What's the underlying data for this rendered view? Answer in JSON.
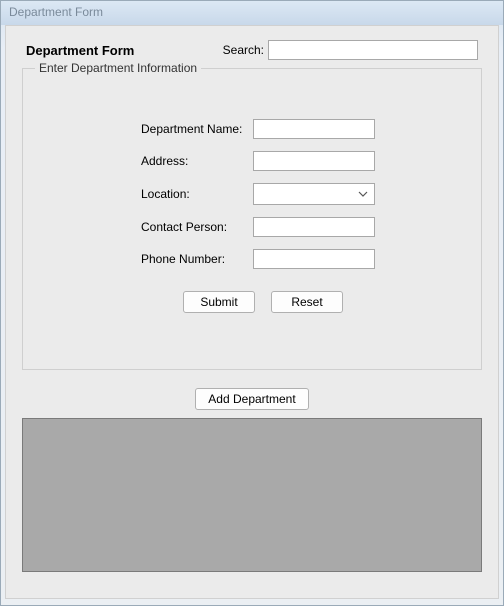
{
  "window": {
    "title": "Department Form"
  },
  "header": {
    "form_title": "Department  Form",
    "search_label": "Search:",
    "search_value": ""
  },
  "group": {
    "legend": "Enter Department Information",
    "fields": {
      "dept_name": {
        "label": "Department Name:",
        "value": ""
      },
      "address": {
        "label": "Address:",
        "value": ""
      },
      "location": {
        "label": "Location:",
        "value": ""
      },
      "contact": {
        "label": "Contact Person:",
        "value": ""
      },
      "phone": {
        "label": "Phone Number:",
        "value": ""
      }
    },
    "buttons": {
      "submit": "Submit",
      "reset": "Reset"
    }
  },
  "actions": {
    "add_department": "Add Department"
  }
}
